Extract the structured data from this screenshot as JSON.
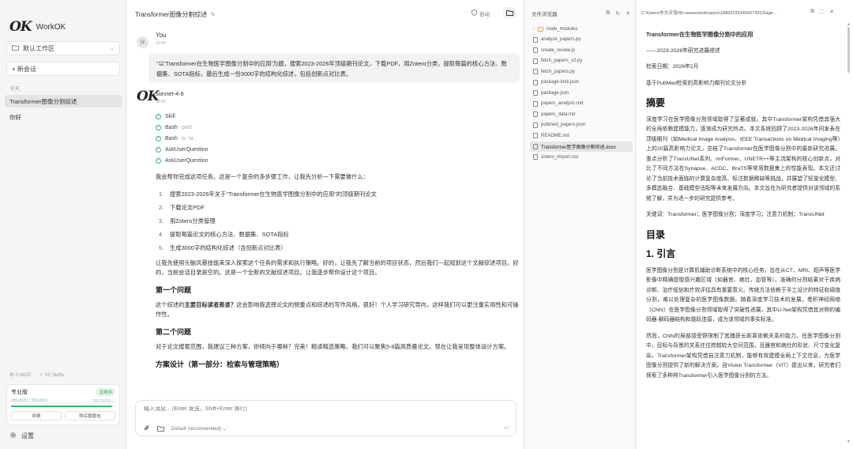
{
  "app": {
    "logo": "OK",
    "name": "WorkOK",
    "workspace": "默认工作区",
    "new_chat": "+ 新会话",
    "section_today": "今天",
    "conversations": [
      {
        "label": "Transformer图像分割综述",
        "active": true
      },
      {
        "label": "你好",
        "active": false
      }
    ],
    "mcp": "0 MCP",
    "skills": "10 Skills",
    "plan": {
      "name": "专业版",
      "badge": "生效中",
      "usage": "289,8020 / 300,0000",
      "expiry": "2027/2/19 ⓘ",
      "usage_fraction": 0.97,
      "btn_renew": "续费",
      "btn_addon": "购买额度包"
    },
    "settings": "设置"
  },
  "chat": {
    "title": "Transformer图像分割综述",
    "auto_label": "自动",
    "user_avatar": "U",
    "user_name": "You",
    "user_time": "10:04",
    "user_message": "\"以'Transformer在生物医学图像分割中的应用'为题，搜索2023-2026年顶级期刊论文，下载PDF，用Zotero分类，提取每篇的核心方法、数据集、SOTA指标，最后生成一份3000字的结构化综述，包括创新点对比表。",
    "ai_name": "sonnet-4-6",
    "ai_time": "10:05",
    "tools": [
      {
        "name": "Skill",
        "arg": ""
      },
      {
        "name": "Bash",
        "arg": "pwd"
      },
      {
        "name": "Bash",
        "arg": "ls -la"
      },
      {
        "name": "AskUserQuestion",
        "arg": ""
      },
      {
        "name": "AskUserQuestion",
        "arg": ""
      }
    ],
    "intro": "我会帮你完成这项任务。这是一个复杂的多步骤工作，让我先分析一下需要做什么：",
    "steps": [
      "搜索2023-2026年关于\"Transformer在生物医学图像分割中的应用\"的顶级期刊论文",
      "下载论文PDF",
      "用Zotero分类管理",
      "提取每篇论文的核心方法、数据集、SOTA指标",
      "生成3000字的结构化综述（含创新点对比表）"
    ],
    "para2": "让我先使用头脑风暴技能来深入探索这个任务的需求和执行策略。好的，让我先了解当前的项目状态，然后我们一起规划这个文献综述项目。好的，当前会话目录是空的。这是一个全新的文献综述项目。让我逐步帮你设计这个项目。",
    "h_first": "第一个问题",
    "q1_pre": "这个综述的",
    "q1_bold": "主要目标读者是谁？",
    "q1_post": "这会影响我选择论文的侧重点和综述的写作风格。很好！个人学习研究导向，这样我们可以更注重实用性和可操作性。",
    "h_second": "第二个问题",
    "q2": "对于论文搜索范围，我建议三种方案，你倾向于哪种？完美！精读精选策略，我们可以聚焦5-8篇高质量论文。现在让我呈现整体设计方案。",
    "h_cut": "方案设计（第一部分：检索与管理策略）",
    "input_placeholder": "输入消息... (Enter 发送，Shift+Enter 换行)",
    "model_label": "Default (recommended)"
  },
  "files": {
    "title": "文件浏览器",
    "items": [
      {
        "name": "node_modules",
        "type": "folder",
        "active": false
      },
      {
        "name": "analyze_papers.py",
        "type": "file",
        "active": false
      },
      {
        "name": "create_review.js",
        "type": "file",
        "active": false
      },
      {
        "name": "fetch_papers_v2.py",
        "type": "file",
        "active": false
      },
      {
        "name": "fetch_papers.py",
        "type": "file",
        "active": false
      },
      {
        "name": "package-lock.json",
        "type": "file",
        "active": false
      },
      {
        "name": "package.json",
        "type": "file",
        "active": false
      },
      {
        "name": "papers_analysis.md",
        "type": "file",
        "active": false
      },
      {
        "name": "papers_data.md",
        "type": "file",
        "active": false
      },
      {
        "name": "pubmed_papers.json",
        "type": "file",
        "active": false
      },
      {
        "name": "README.md",
        "type": "file",
        "active": false
      },
      {
        "name": "Transformer医学图像分割综述.docx",
        "type": "file",
        "active": true
      },
      {
        "name": "zotero_import.csv",
        "type": "file",
        "active": false
      }
    ]
  },
  "doc": {
    "path": "C:\\Users\\东方天穹06\\.newworkok\\users\\189622332404273913\\age...",
    "title": "Transformer在生物医学图像分割中的应用",
    "subtitle": "——2023-2026年研究进展综述",
    "date": "检索日期：2026年2月",
    "basis": "基于PubMed检索的高影响力期刊论文分析",
    "h_abstract": "摘要",
    "abstract": "深度学习在医学图像分割领域取得了显著成就。其中Transformer架构凭借其强大的全局依赖建模能力，逐渐成为研究热点。本文系统回顾了2023-2026年间发表在顶级期刊（如Medical Image Analysis、IEEE Transactions on Medical Imaging等）上的20篇高影响力论文，总结了Transformer在医学图像分割中的最新研究进展。重点分析了TransUNet系列、nnFormer、UNETR++等主流架构的核心创新点，对比了不同方法在Synapse、ACDC、BraTS等常用数据集上的性能表现。本文还讨论了当前技术面临的计算复杂度高、标注数据稀缺等挑战，并展望了轻量化模型、多模态融合、基础模型适配等未来发展方向。本文旨在为研究者提供对该领域的系统了解，并为进一步的研究提供参考。",
    "keywords": "关键词：Transformer；医学图像分割；深度学习；注意力机制；TransUNet",
    "h_toc": "目录",
    "h_intro": "1. 引言",
    "intro1": "医学图像分割是计算机辅助诊断系统中的核心任务，旨在从CT、MRI、超声等医学影像中精确提取感兴趣区域（如器官、病灶、血管等）。准确的分割结果对于疾病诊断、治疗规划和疗效评估具有重要意义。传统方法依赖于手工设计的特征和阈值分割，难以处理复杂的医学图像数据。随着深度学习技术的发展，卷积神经网络（CNN）在医学图像分割领域取得了突破性进展，其中U-Net架构凭借其对称的编码器-解码器结构和跳跃连接，成为该领域的事实标准。",
    "intro2": "然而，CNN的局部感受野限制了其捕获长距离依赖关系的能力。在医学图像分割中，目标与背景的关系往往跨越较大空间范围，且器官和病灶的形状、尺寸变化复杂。Transformer架构凭借自注意力机制，能够有效建模全局上下文信息，为医学图像分割提供了新的解决方案。自Vision Transformer（ViT）提出以来，研究者们探索了多种将Transformer引入医学图像分割的方法。"
  }
}
